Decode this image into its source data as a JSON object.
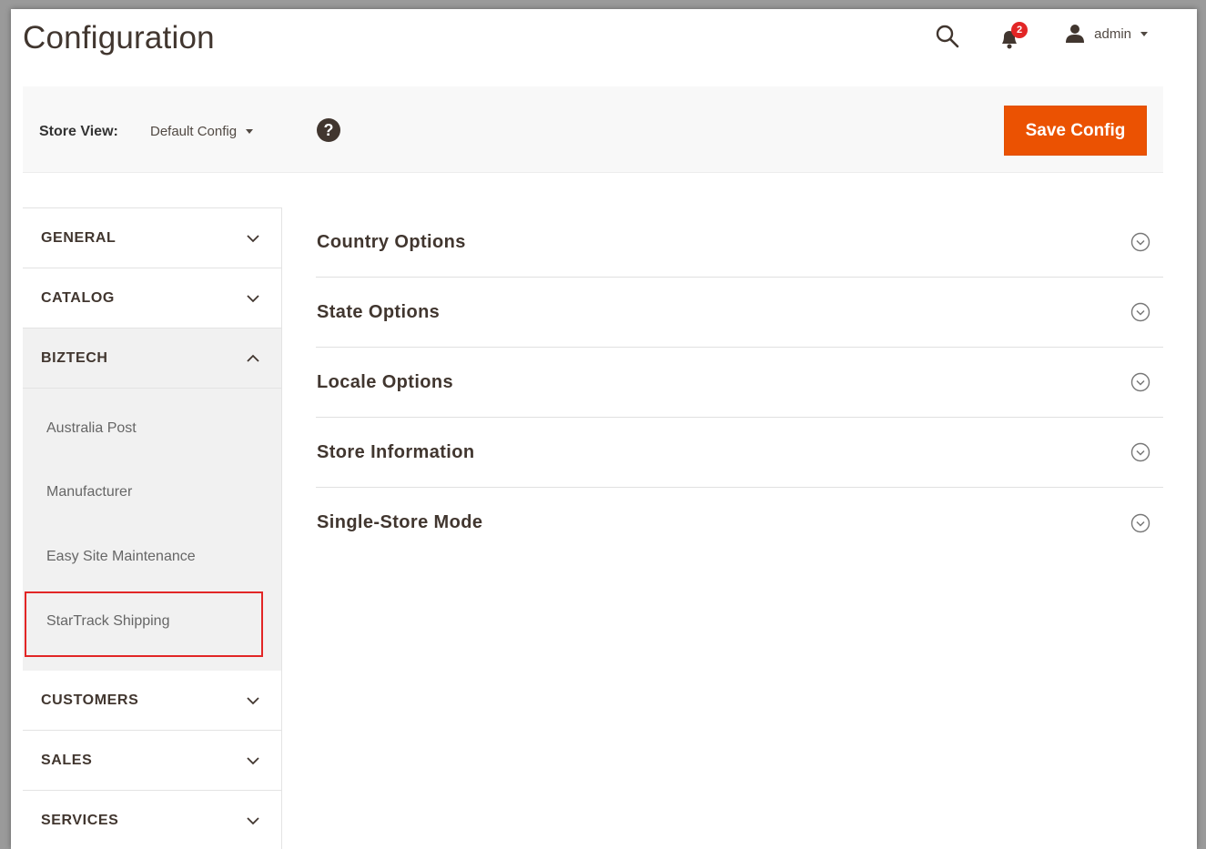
{
  "header": {
    "title": "Configuration",
    "notifications_count": "2",
    "user_name": "admin"
  },
  "store_bar": {
    "label": "Store View:",
    "selected": "Default Config",
    "help_symbol": "?",
    "save_label": "Save Config"
  },
  "sidebar": {
    "sections": [
      {
        "label": "GENERAL",
        "expanded": false
      },
      {
        "label": "CATALOG",
        "expanded": false
      },
      {
        "label": "BIZTECH",
        "expanded": true
      },
      {
        "label": "CUSTOMERS",
        "expanded": false
      },
      {
        "label": "SALES",
        "expanded": false
      },
      {
        "label": "SERVICES",
        "expanded": false
      }
    ],
    "biztech_items": [
      "Australia Post",
      "Manufacturer",
      "Easy Site Maintenance",
      "StarTrack Shipping"
    ]
  },
  "main": {
    "panels": [
      "Country Options",
      "State Options",
      "Locale Options",
      "Store Information",
      "Single-Store Mode"
    ]
  },
  "colors": {
    "accent": "#eb5202",
    "badge": "#e22626",
    "highlight": "#e22626",
    "text": "#41362f"
  },
  "icons": {
    "search": "search-icon",
    "bell": "bell-icon",
    "user": "user-icon",
    "help": "help-icon",
    "chevron": "chevron-down-icon",
    "circle_chevron": "circle-chevron-icon"
  }
}
